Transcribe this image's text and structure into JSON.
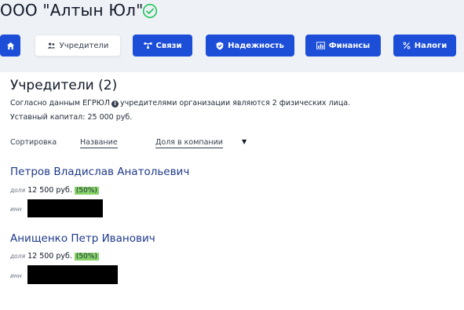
{
  "header": {
    "company_name": "ООО \"Алтын Юл\"",
    "verified_icon": "check-circle-icon"
  },
  "tabs": [
    {
      "label": "",
      "icon": "home-icon"
    },
    {
      "label": "Учредители",
      "icon": "users-icon",
      "active": true
    },
    {
      "label": "Связи",
      "icon": "network-icon"
    },
    {
      "label": "Надежность",
      "icon": "shield-icon"
    },
    {
      "label": "Финансы",
      "icon": "bar-chart-icon"
    },
    {
      "label": "Налоги",
      "icon": "percent-icon"
    }
  ],
  "section": {
    "title": "Учредители (2)",
    "info_prefix": "Согласно данным ЕГРЮЛ",
    "info_suffix": "учредителями организации являются 2 физических лица.",
    "capital": "Уставный капитал: 25 000 руб."
  },
  "sort": {
    "label": "Сортировка",
    "by_name": "Название",
    "by_share": "Доля в компании",
    "arrow": "▼"
  },
  "founders": [
    {
      "name": "Петров Владислав Анатольевич",
      "share_label": "доля",
      "share_amount": "12 500 руб.",
      "share_percent": "(50%)",
      "share_fraction": 0.5,
      "inn_label": "инн"
    },
    {
      "name": "Анищенко Петр Иванович",
      "share_label": "доля",
      "share_amount": "12 500 руб.",
      "share_percent": "(50%)",
      "share_fraction": 0.5,
      "inn_label": "инн"
    }
  ],
  "colors": {
    "tab_blue": "#1d4ed8",
    "header_bg": "#eef1f6",
    "share_highlight": "#86d36a",
    "verified_green": "#22c55e"
  }
}
